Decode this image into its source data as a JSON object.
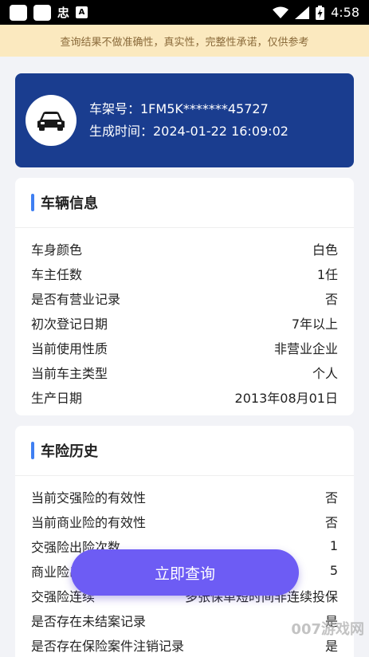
{
  "status_bar": {
    "glyph": "忠",
    "badge": "A",
    "time": "4:58"
  },
  "notice": "查询结果不做准确性，真实性，完整性承诺，仅供参考",
  "vin_card": {
    "vin": "车架号：1FM5K*******45727",
    "generated": "生成时间：2024-01-22 16:09:02"
  },
  "vehicle_info": {
    "title": "车辆信息",
    "rows": [
      {
        "label": "车身颜色",
        "value": "白色"
      },
      {
        "label": "车主任数",
        "value": "1任"
      },
      {
        "label": "是否有营业记录",
        "value": "否"
      },
      {
        "label": "初次登记日期",
        "value": "7年以上"
      },
      {
        "label": "当前使用性质",
        "value": "非营业企业"
      },
      {
        "label": "当前车主类型",
        "value": "个人"
      },
      {
        "label": "生产日期",
        "value": "2013年08月01日"
      }
    ]
  },
  "insurance": {
    "title": "车险历史",
    "rows": [
      {
        "label": "当前交强险的有效性",
        "value": "否"
      },
      {
        "label": "当前商业险的有效性",
        "value": "否"
      },
      {
        "label": "交强险出险次数",
        "value": "1"
      },
      {
        "label": "商业险出险次数",
        "value": "5"
      },
      {
        "label": "交强险连续",
        "value": "多张保单短时间非连续投保"
      },
      {
        "label": "是否存在未结案记录",
        "value": "是"
      },
      {
        "label": "是否存在保险案件注销记录",
        "value": "是"
      }
    ]
  },
  "query_button": "立即查询",
  "watermark": "007游戏网"
}
